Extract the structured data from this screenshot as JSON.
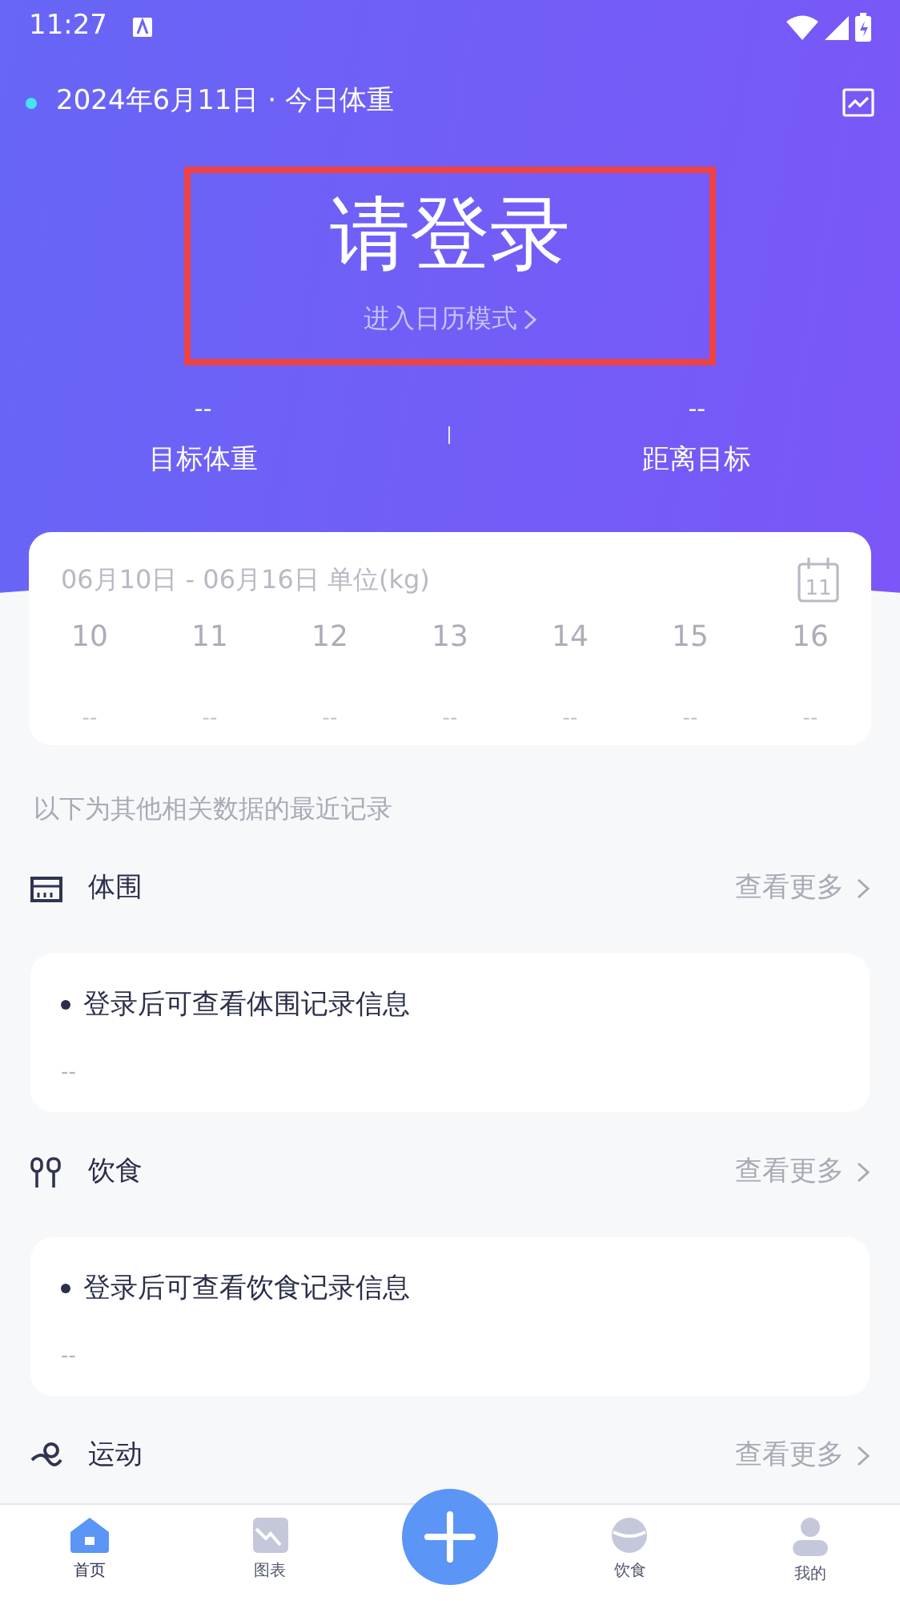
{
  "status_bar": {
    "time": "11:27"
  },
  "header": {
    "date": "2024年6月11日 · 今日体重"
  },
  "login": {
    "title": "请登录",
    "link": "进入日历模式",
    "highlighted": true
  },
  "stats": [
    {
      "value": "--",
      "label": "目标体重"
    },
    {
      "value": "--",
      "label": "距离目标"
    }
  ],
  "week_card": {
    "range": "06月10日 - 06月16日 单位(kg)",
    "calendar_day": "11",
    "days": [
      {
        "day": "10",
        "value": "--"
      },
      {
        "day": "11",
        "value": "--"
      },
      {
        "day": "12",
        "value": "--"
      },
      {
        "day": "13",
        "value": "--"
      },
      {
        "day": "14",
        "value": "--"
      },
      {
        "day": "15",
        "value": "--"
      },
      {
        "day": "16",
        "value": "--"
      }
    ]
  },
  "caption": "以下为其他相关数据的最近记录",
  "sections": [
    {
      "kind": "body",
      "title": "体围",
      "more": "查看更多",
      "note": "登录后可查看体围记录信息",
      "value": "--"
    },
    {
      "kind": "diet",
      "title": "饮食",
      "more": "查看更多",
      "note": "登录后可查看饮食记录信息",
      "value": "--"
    },
    {
      "kind": "exercise",
      "title": "运动",
      "more": "查看更多"
    }
  ],
  "bottom_nav": [
    {
      "kind": "home",
      "label": "首页",
      "selected": true
    },
    {
      "kind": "chart",
      "label": "图表",
      "selected": false
    },
    {
      "kind": "add"
    },
    {
      "kind": "diet",
      "label": "饮食",
      "selected": false
    },
    {
      "kind": "profile",
      "label": "我的",
      "selected": false
    }
  ]
}
